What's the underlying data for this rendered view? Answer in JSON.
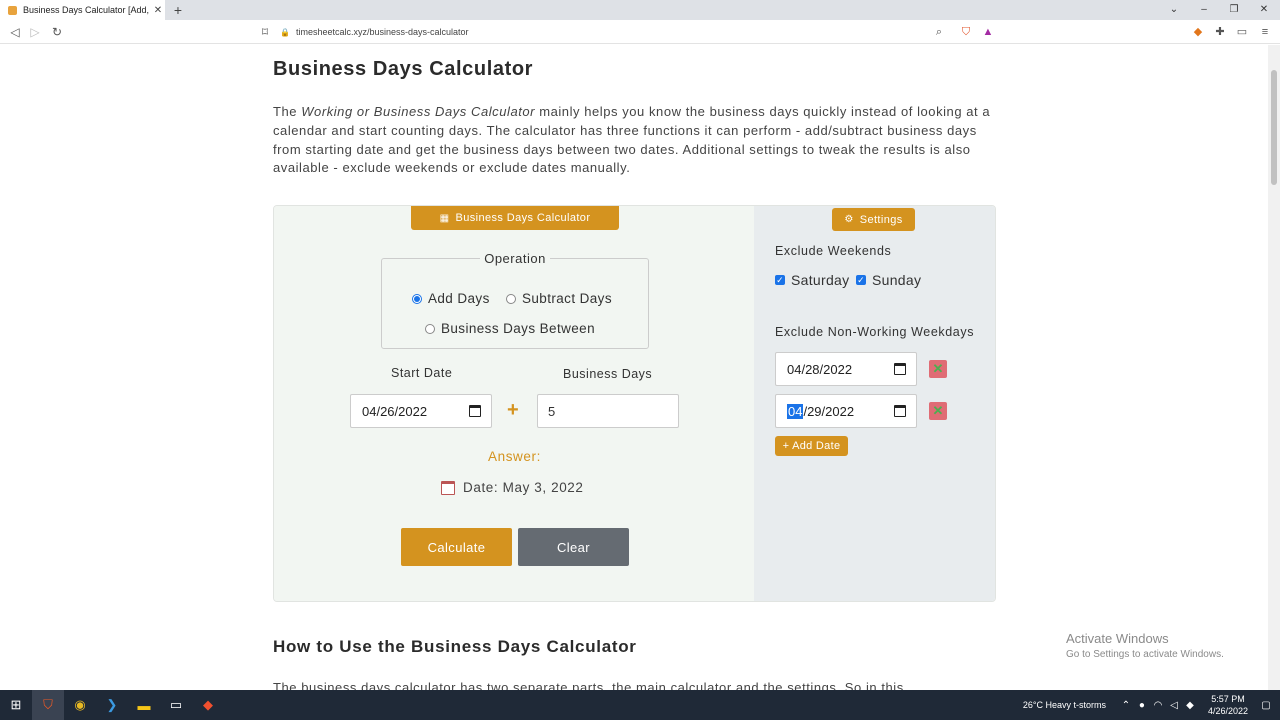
{
  "browser": {
    "tab_title": "Business Days Calculator [Add, Su",
    "url": "timesheetcalc.xyz/business-days-calculator"
  },
  "page": {
    "title": "Business Days Calculator",
    "intro_pre": "The ",
    "intro_em": "Working or Business Days Calculator",
    "intro_post": " mainly helps you know the business days quickly instead of looking at a calendar and start counting days. The calculator has three functions it can perform - add/subtract business days from starting date and get the business days between two dates. Additional settings to tweak the results is also available - exclude weekends or exclude dates manually.",
    "section2_title": "How to Use the Business Days Calculator",
    "section2_text": "The business days calculator has two separate parts, the main calculator and the settings. So in this"
  },
  "calculator": {
    "header": "Business Days Calculator",
    "operation_legend": "Operation",
    "operations": [
      {
        "label": "Add Days",
        "selected": true
      },
      {
        "label": "Subtract Days",
        "selected": false
      },
      {
        "label": "Business Days Between",
        "selected": false
      }
    ],
    "start_date_label": "Start Date",
    "start_date_value": "04/26/2022",
    "business_days_label": "Business Days",
    "business_days_value": "5",
    "plus_sign": "+",
    "answer_label": "Answer:",
    "result": "Date: May 3, 2022",
    "calculate_label": "Calculate",
    "clear_label": "Clear"
  },
  "settings": {
    "header": "Settings",
    "exclude_weekends_label": "Exclude Weekends",
    "saturday_label": "Saturday",
    "sunday_label": "Sunday",
    "saturday_checked": true,
    "sunday_checked": true,
    "exclude_weekdays_label": "Exclude Non-Working Weekdays",
    "excluded_dates": [
      {
        "value": "04/28/2022"
      },
      {
        "sel": "04",
        "rest": "/29/2022"
      }
    ],
    "add_date_label": "+ Add Date"
  },
  "activate": {
    "line1": "Activate Windows",
    "line2": "Go to Settings to activate Windows."
  },
  "taskbar": {
    "weather": "26°C  Heavy t-storms",
    "time": "5:57 PM",
    "date": "4/26/2022"
  },
  "colors": {
    "accent": "#d4931f",
    "clear_button": "#656b72",
    "panel_left": "#f2f6f2",
    "panel_right": "#e8ecee"
  }
}
